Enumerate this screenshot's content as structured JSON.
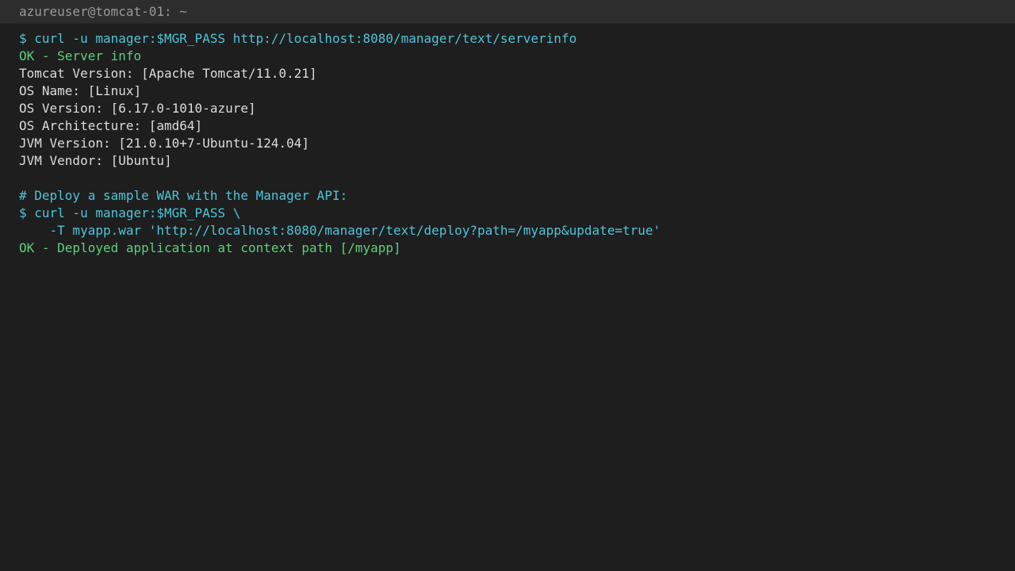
{
  "window": {
    "title": "azureuser@tomcat-01: ~"
  },
  "colors": {
    "background": "#1e1e1e",
    "titlebar": "#2d2d2d",
    "command": "#4ec4d8",
    "success": "#5fcf7a",
    "text": "#dcdcdc"
  },
  "terminal": {
    "lines": [
      "$ curl -u manager:$MGR_PASS http://localhost:8080/manager/text/serverinfo",
      "OK - Server info",
      "Tomcat Version: [Apache Tomcat/11.0.21]",
      "OS Name: [Linux]",
      "OS Version: [6.17.0-1010-azure]",
      "OS Architecture: [amd64]",
      "JVM Version: [21.0.10+7-Ubuntu-124.04]",
      "JVM Vendor: [Ubuntu]",
      "",
      "# Deploy a sample WAR with the Manager API:",
      "$ curl -u manager:$MGR_PASS \\",
      "    -T myapp.war 'http://localhost:8080/manager/text/deploy?path=/myapp&update=true'",
      "OK - Deployed application at context path [/myapp]"
    ]
  }
}
